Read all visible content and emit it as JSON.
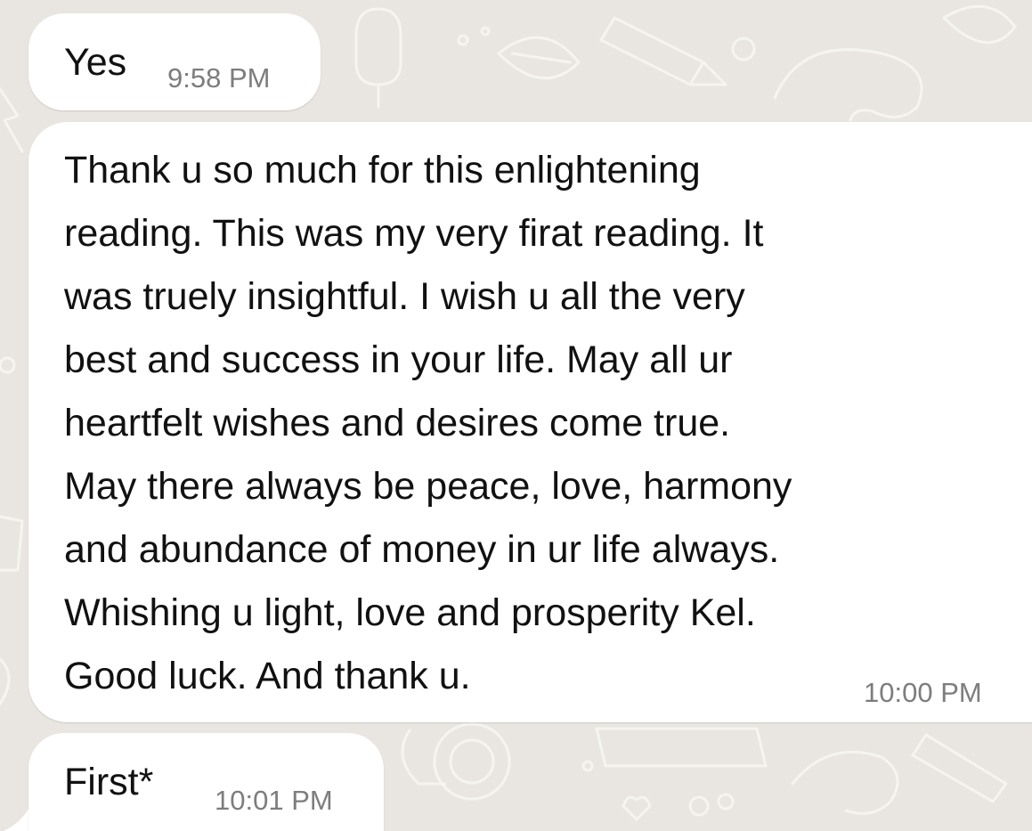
{
  "conversation": {
    "messages": [
      {
        "text": "Yes",
        "time": "9:58 PM"
      },
      {
        "lines": [
          "Thank u so much for this enlightening",
          "reading. This was my very firat reading. It",
          "was truely insightful. I wish u all the very",
          "best and success in your life. May all ur",
          "heartfelt wishes and desires come true.",
          "May there always be peace, love, harmony",
          "and abundance of money in ur life always.",
          "Whishing u light, love and prosperity Kel.",
          "Good luck. And thank u."
        ],
        "time": "10:00 PM"
      },
      {
        "text": "First*",
        "time": "10:01 PM"
      }
    ]
  },
  "theme": {
    "wallpaper": "#e9e6e1",
    "bubble": "#ffffff",
    "text": "#111111",
    "timestamp": "#7d7d7d"
  }
}
